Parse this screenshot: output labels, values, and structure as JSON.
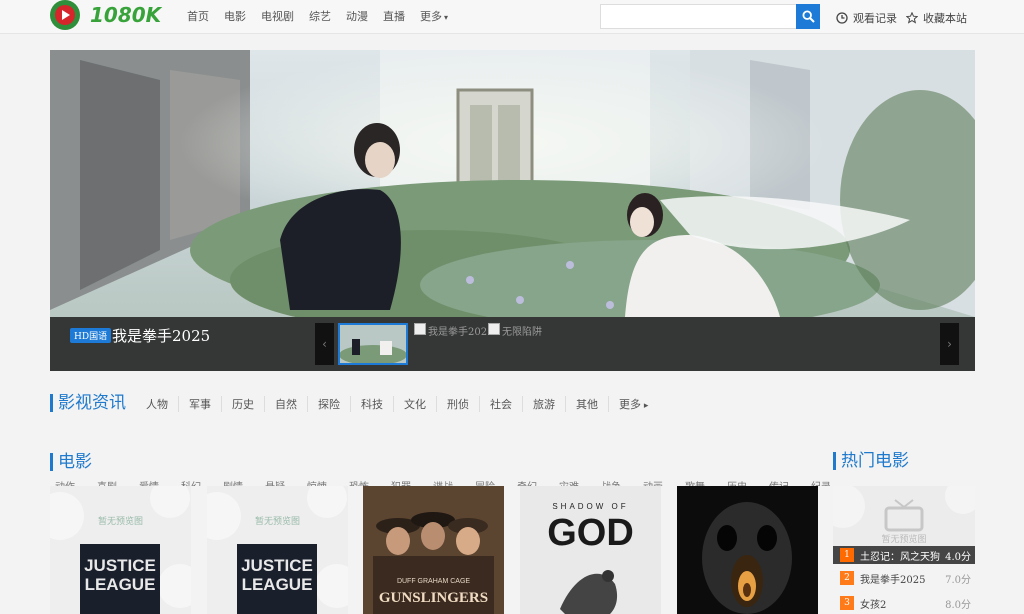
{
  "header": {
    "logo_text": "1080K",
    "nav": [
      {
        "label": "首页"
      },
      {
        "label": "电影"
      },
      {
        "label": "电视剧"
      },
      {
        "label": "综艺"
      },
      {
        "label": "动漫"
      },
      {
        "label": "直播"
      },
      {
        "label": "更多"
      }
    ],
    "search_placeholder": "",
    "history_label": "观看记录",
    "favorite_label": "收藏本站"
  },
  "banner": {
    "badge": "HD国语",
    "title": "我是拳手2025",
    "thumbs": [
      {
        "alt": ""
      },
      {
        "alt": "我是拳手2025"
      },
      {
        "alt": "无限陷阱"
      }
    ]
  },
  "news": {
    "title": "影视资讯",
    "tags": [
      "人物",
      "军事",
      "历史",
      "自然",
      "探险",
      "科技",
      "文化",
      "刑侦",
      "社会",
      "旅游",
      "其他",
      "更多"
    ]
  },
  "movies": {
    "title": "电影",
    "subtags": [
      "动作",
      "喜剧",
      "爱情",
      "科幻",
      "剧情",
      "悬疑",
      "惊悚",
      "恐怖",
      "犯罪",
      "谍战",
      "冒险",
      "奇幻",
      "灾难",
      "战争",
      "动画",
      "歌舞",
      "历史",
      "传记",
      "纪录"
    ],
    "cards": [
      {
        "placeholder": "暂无预览图",
        "poster_text": "JUSTICE LEAGUE"
      },
      {
        "placeholder": "暂无预览图",
        "poster_text": "JUSTICE LEAGUE"
      },
      {
        "poster_text": "GUNSLINGERS",
        "names": "DUFF  GRAHAM  CAGE"
      },
      {
        "poster_text": "GOD",
        "poster_top": "SHADOW OF"
      },
      {
        "poster_text": ""
      }
    ]
  },
  "hot": {
    "title": "热门电影",
    "placeholder": "暂无预览图",
    "items": [
      {
        "rank": "1",
        "name": "土忍记：风之天狗",
        "score": "4.0分"
      },
      {
        "rank": "2",
        "name": "我是拳手2025",
        "score": "7.0分"
      },
      {
        "rank": "3",
        "name": "女孩2",
        "score": "8.0分"
      }
    ]
  }
}
